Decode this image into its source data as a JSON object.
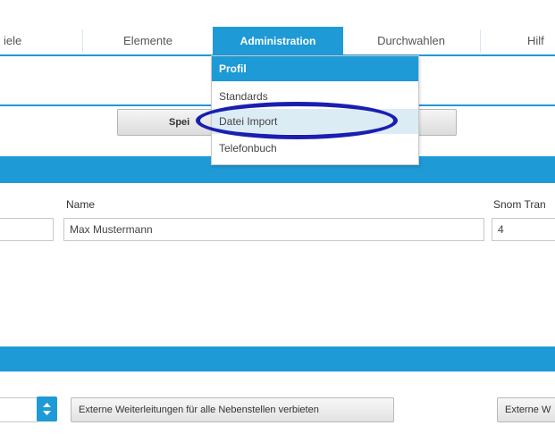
{
  "nav": {
    "items": [
      {
        "label": "iele"
      },
      {
        "label": "Elemente"
      },
      {
        "label": "Administration"
      },
      {
        "label": "Durchwahlen"
      },
      {
        "label": "Hilf"
      }
    ]
  },
  "toolbar": {
    "save_label": "Spei"
  },
  "dropdown": {
    "items": [
      {
        "label": "Profil"
      },
      {
        "label": "Standards"
      },
      {
        "label": "Datei Import"
      },
      {
        "label": "Telefonbuch"
      }
    ]
  },
  "form": {
    "name_label": "Name",
    "name_value": "Max Mustermann",
    "snom_label": "Snom Tran",
    "snom_value": "4"
  },
  "bottom": {
    "forward_button": "Externe Weiterleitungen für alle Nebenstellen verbieten",
    "right_button": "Externe W"
  },
  "colors": {
    "accent": "#1e9ad6",
    "highlight": "#1a1fb0"
  }
}
